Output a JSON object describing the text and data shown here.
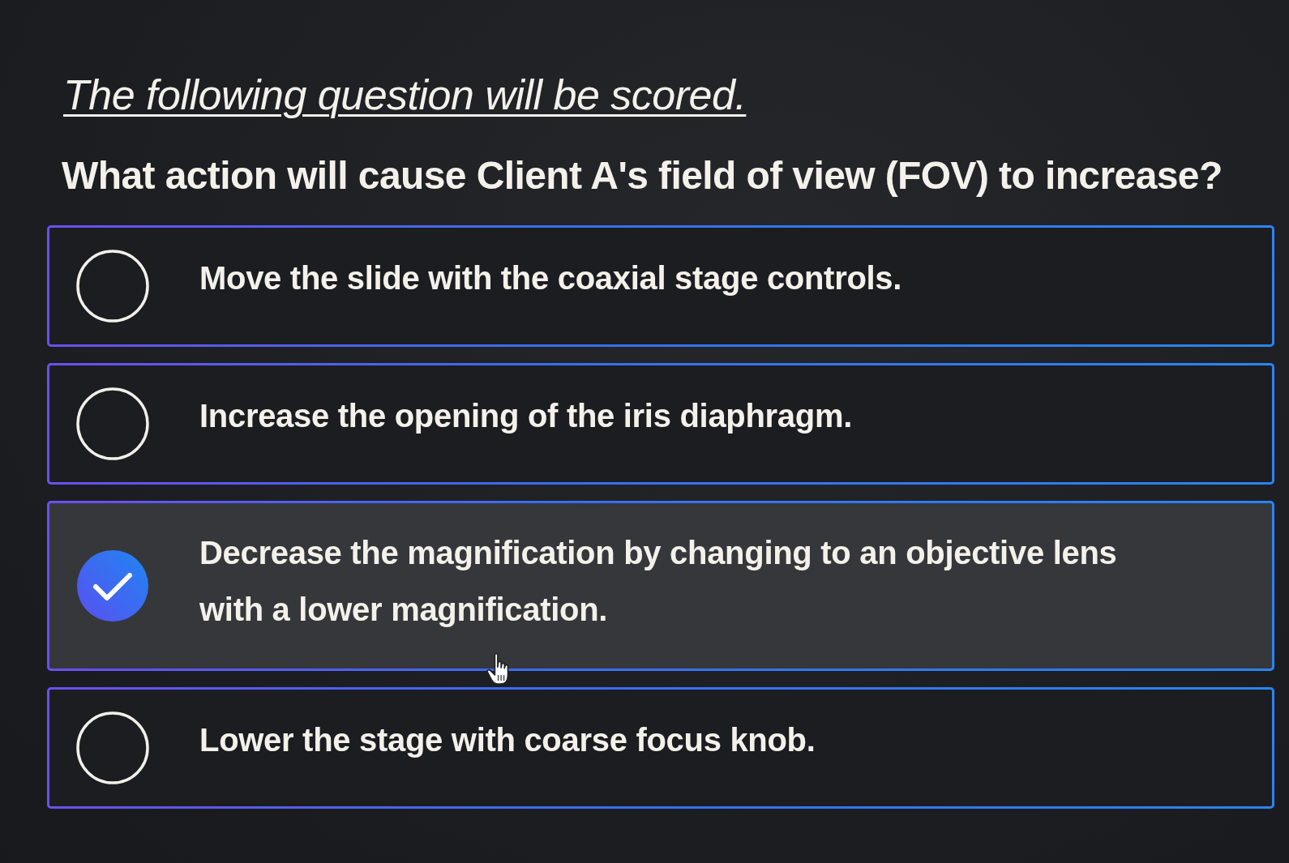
{
  "heading": "The following question will be scored.",
  "question": "What action will cause Client A's field of view (FOV) to increase?",
  "options": [
    {
      "label": "Move the slide with the coaxial stage controls.",
      "selected": false
    },
    {
      "label": "Increase the opening of the iris diaphragm.",
      "selected": false
    },
    {
      "label": "Decrease the magnification by changing to an objective lens with a lower magnification.",
      "selected": true
    },
    {
      "label": "Lower the stage with coarse focus knob.",
      "selected": false
    }
  ]
}
